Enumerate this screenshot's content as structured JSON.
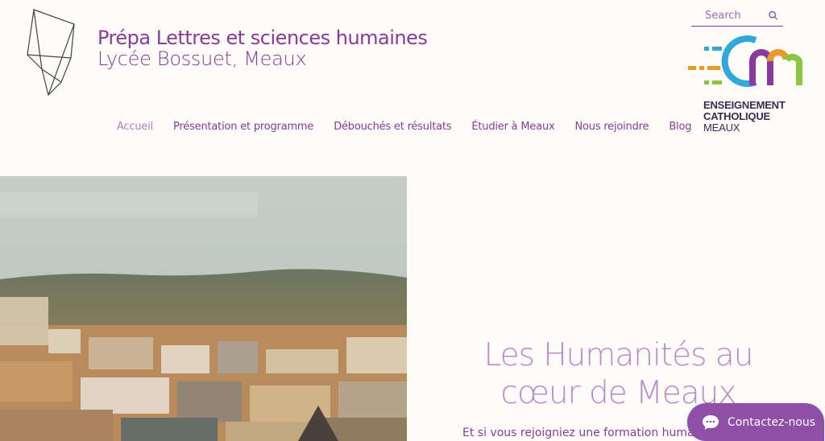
{
  "header": {
    "title": "Prépa Lettres et sciences humaines",
    "subtitle": "Lycée Bossuet, Meaux"
  },
  "search": {
    "placeholder": "Search",
    "icon": "search-icon"
  },
  "partner_logo": {
    "lines": [
      "ENSEIGNEMENT",
      "CATHOLIQUE",
      "MEAUX"
    ],
    "colors": [
      "#e89a2c",
      "#2ea9d8",
      "#8cc63f",
      "#8a3a9c"
    ]
  },
  "nav": {
    "items": [
      {
        "label": "Accueil",
        "active": true
      },
      {
        "label": "Présentation et programme"
      },
      {
        "label": "Débouchés et résultats"
      },
      {
        "label": "Étudier à Meaux"
      },
      {
        "label": "Nous rejoindre"
      },
      {
        "label": "Blog"
      }
    ]
  },
  "hero": {
    "heading": "Les Humanités au cœur de Meaux",
    "text": "Et si vous rejoigniez une formation humaniste,"
  },
  "contact": {
    "label": "Contactez-nous",
    "icon": "chat-icon"
  },
  "colors": {
    "accent": "#8a3a9c",
    "heading_light": "#bd88cc",
    "background": "#fdfcf8"
  }
}
